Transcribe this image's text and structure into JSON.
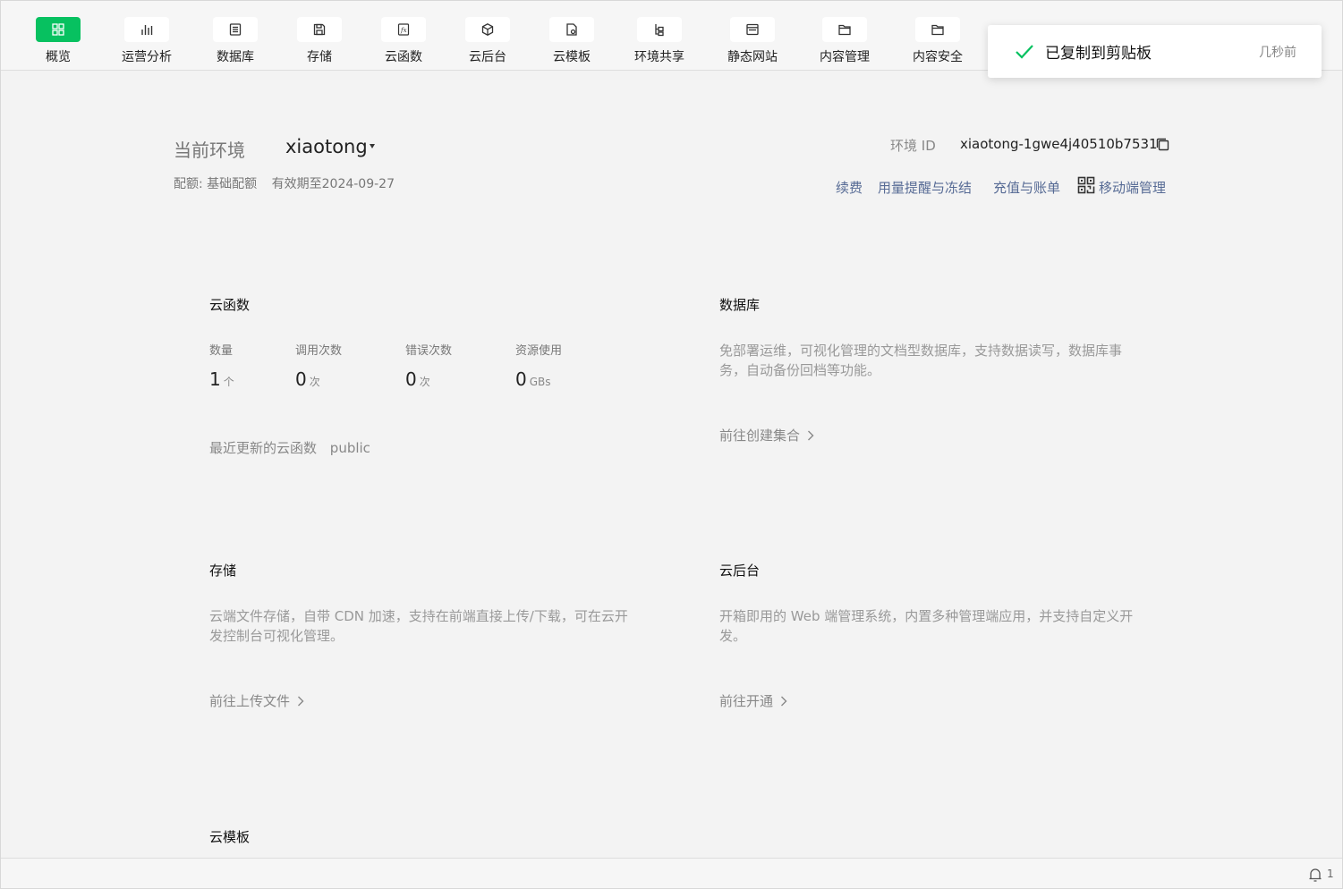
{
  "toolbar": {
    "items": [
      {
        "label": "概览",
        "icon": "grid-icon",
        "active": true
      },
      {
        "label": "运营分析",
        "icon": "bar-chart-icon"
      },
      {
        "label": "数据库",
        "icon": "database-icon"
      },
      {
        "label": "存储",
        "icon": "save-icon"
      },
      {
        "label": "云函数",
        "icon": "function-icon"
      },
      {
        "label": "云后台",
        "icon": "cube-icon"
      },
      {
        "label": "云模板",
        "icon": "template-icon"
      },
      {
        "label": "环境共享",
        "icon": "share-tree-icon"
      },
      {
        "label": "静态网站",
        "icon": "browser-icon"
      },
      {
        "label": "内容管理",
        "icon": "folder-icon"
      },
      {
        "label": "内容安全",
        "icon": "folder-icon"
      }
    ]
  },
  "toast": {
    "message": "已复制到剪贴板",
    "time": "几秒前",
    "accent": "#07c160"
  },
  "env": {
    "title": "当前环境",
    "name": "xiaotong",
    "quota": "配额: 基础配额",
    "valid_until": "有效期至2024-09-27",
    "id_label": "环境 ID",
    "id_value": "xiaotong-1gwe4j40510b7531"
  },
  "links": {
    "renew": "续费",
    "usage_alert": "用量提醒与冻结",
    "recharge": "充值与账单",
    "mobile": "移动端管理",
    "color": "#576b95"
  },
  "cloud_functions": {
    "title": "云函数",
    "stats": [
      {
        "label": "数量",
        "value": "1",
        "unit": "个"
      },
      {
        "label": "调用次数",
        "value": "0",
        "unit": "次"
      },
      {
        "label": "错误次数",
        "value": "0",
        "unit": "次"
      },
      {
        "label": "资源使用",
        "value": "0",
        "unit": "GBs"
      }
    ],
    "recent_label": "最近更新的云函数",
    "recent_value": "public"
  },
  "database": {
    "title": "数据库",
    "description": "免部署运维，可视化管理的文档型数据库，支持数据读写，数据库事务，自动备份回档等功能。",
    "action": "前往创建集合"
  },
  "storage": {
    "title": "存储",
    "description": "云端文件存储，自带 CDN 加速，支持在前端直接上传/下载，可在云开发控制台可视化管理。",
    "action": "前往上传文件"
  },
  "cloud_admin": {
    "title": "云后台",
    "description": "开箱即用的 Web 端管理系统，内置多种管理端应用，并支持自定义开发。",
    "action": "前往开通"
  },
  "cloud_template": {
    "title": "云模板"
  },
  "footer": {
    "notification_count": "1"
  }
}
